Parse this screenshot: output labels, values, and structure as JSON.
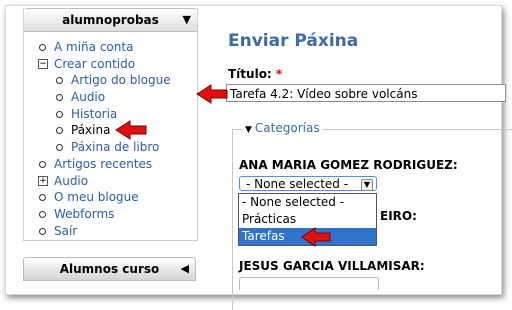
{
  "sidebar": {
    "user_block": {
      "title": "alumnoprobas",
      "collapse_glyph": "▼",
      "items": [
        {
          "label": "A miña conta",
          "type": "link"
        },
        {
          "label": "Crear contido",
          "type": "expanded"
        },
        {
          "label": "Artigo do blogue",
          "type": "link"
        },
        {
          "label": "Audio",
          "type": "link"
        },
        {
          "label": "Historia",
          "type": "link"
        },
        {
          "label": "Páxina",
          "type": "active"
        },
        {
          "label": "Páxina de libro",
          "type": "link"
        },
        {
          "label": "Artigos recentes",
          "type": "link"
        },
        {
          "label": "Audio",
          "type": "collapsed"
        },
        {
          "label": "O meu blogue",
          "type": "link"
        },
        {
          "label": "Webforms",
          "type": "link"
        },
        {
          "label": "Saír",
          "type": "link"
        }
      ]
    },
    "courses_block": {
      "title": "Alumnos curso",
      "collapse_glyph": "◀"
    }
  },
  "main": {
    "page_title": "Enviar Páxina",
    "title_field": {
      "label": "Título:",
      "required_mark": "*",
      "value": "Tarefa 4.2: Vídeo sobre volcáns"
    },
    "categories": {
      "legend": "Categorías",
      "people": [
        {
          "name": "ANA MARIA GOMEZ RODRIGUEZ:",
          "selected": "- None selected -"
        },
        {
          "name": "EIRO:",
          "selected": ""
        },
        {
          "name": "JESUS GARCIA VILLAMISAR:",
          "selected": ""
        }
      ],
      "dropdown_options": [
        "- None selected -",
        "Prácticas",
        "Tarefas"
      ],
      "highlighted_option": "Tarefas"
    }
  },
  "colors": {
    "link": "#2a5db0",
    "title": "#3d6aa2",
    "arrow": "#e01010",
    "selection": "#2f74c9"
  },
  "annotation_arrows": [
    "pointer-arrow-icon",
    "pointer-arrow-icon",
    "pointer-arrow-icon"
  ]
}
